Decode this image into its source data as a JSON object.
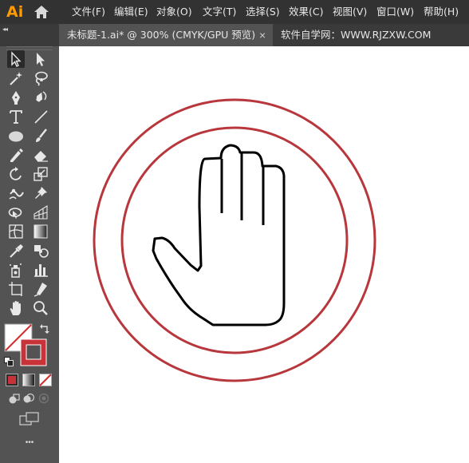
{
  "app": {
    "logo": "Ai"
  },
  "menu": [
    {
      "label": "文件(F)"
    },
    {
      "label": "编辑(E)"
    },
    {
      "label": "对象(O)"
    },
    {
      "label": "文字(T)"
    },
    {
      "label": "选择(S)"
    },
    {
      "label": "效果(C)"
    },
    {
      "label": "视图(V)"
    },
    {
      "label": "窗口(W)"
    },
    {
      "label": "帮助(H)"
    }
  ],
  "document_tab": {
    "title": "未标题-1.ai* @ 300% (CMYK/GPU 预览)",
    "close": "×"
  },
  "watermark": "软件自学网：WWW.RJZXW.COM",
  "panel": {
    "collapse": "◂◂",
    "more": "•••"
  },
  "tools": [
    "selection-tool",
    "direct-selection-tool",
    "magic-wand-tool",
    "lasso-tool",
    "pen-tool",
    "curvature-tool",
    "type-tool",
    "line-segment-tool",
    "ellipse-tool",
    "paintbrush-tool",
    "pencil-tool",
    "eraser-tool",
    "rotate-tool",
    "scale-tool",
    "puppet-warp-tool",
    "pin-tool",
    "free-transform-tool",
    "perspective-grid-tool",
    "mesh-tool",
    "gradient-tool",
    "eyedropper-tool",
    "blend-tool",
    "symbol-sprayer-tool",
    "column-graph-tool",
    "artboard-tool",
    "slice-tool",
    "hand-tool",
    "zoom-tool"
  ],
  "colors": {
    "accent": "#ff9a00",
    "menubar": "#323232",
    "panel": "#535353",
    "ring": "#b8373c",
    "stroke_swatch": "#c8333a",
    "hand_stroke": "#000000",
    "canvas": "#ffffff"
  }
}
